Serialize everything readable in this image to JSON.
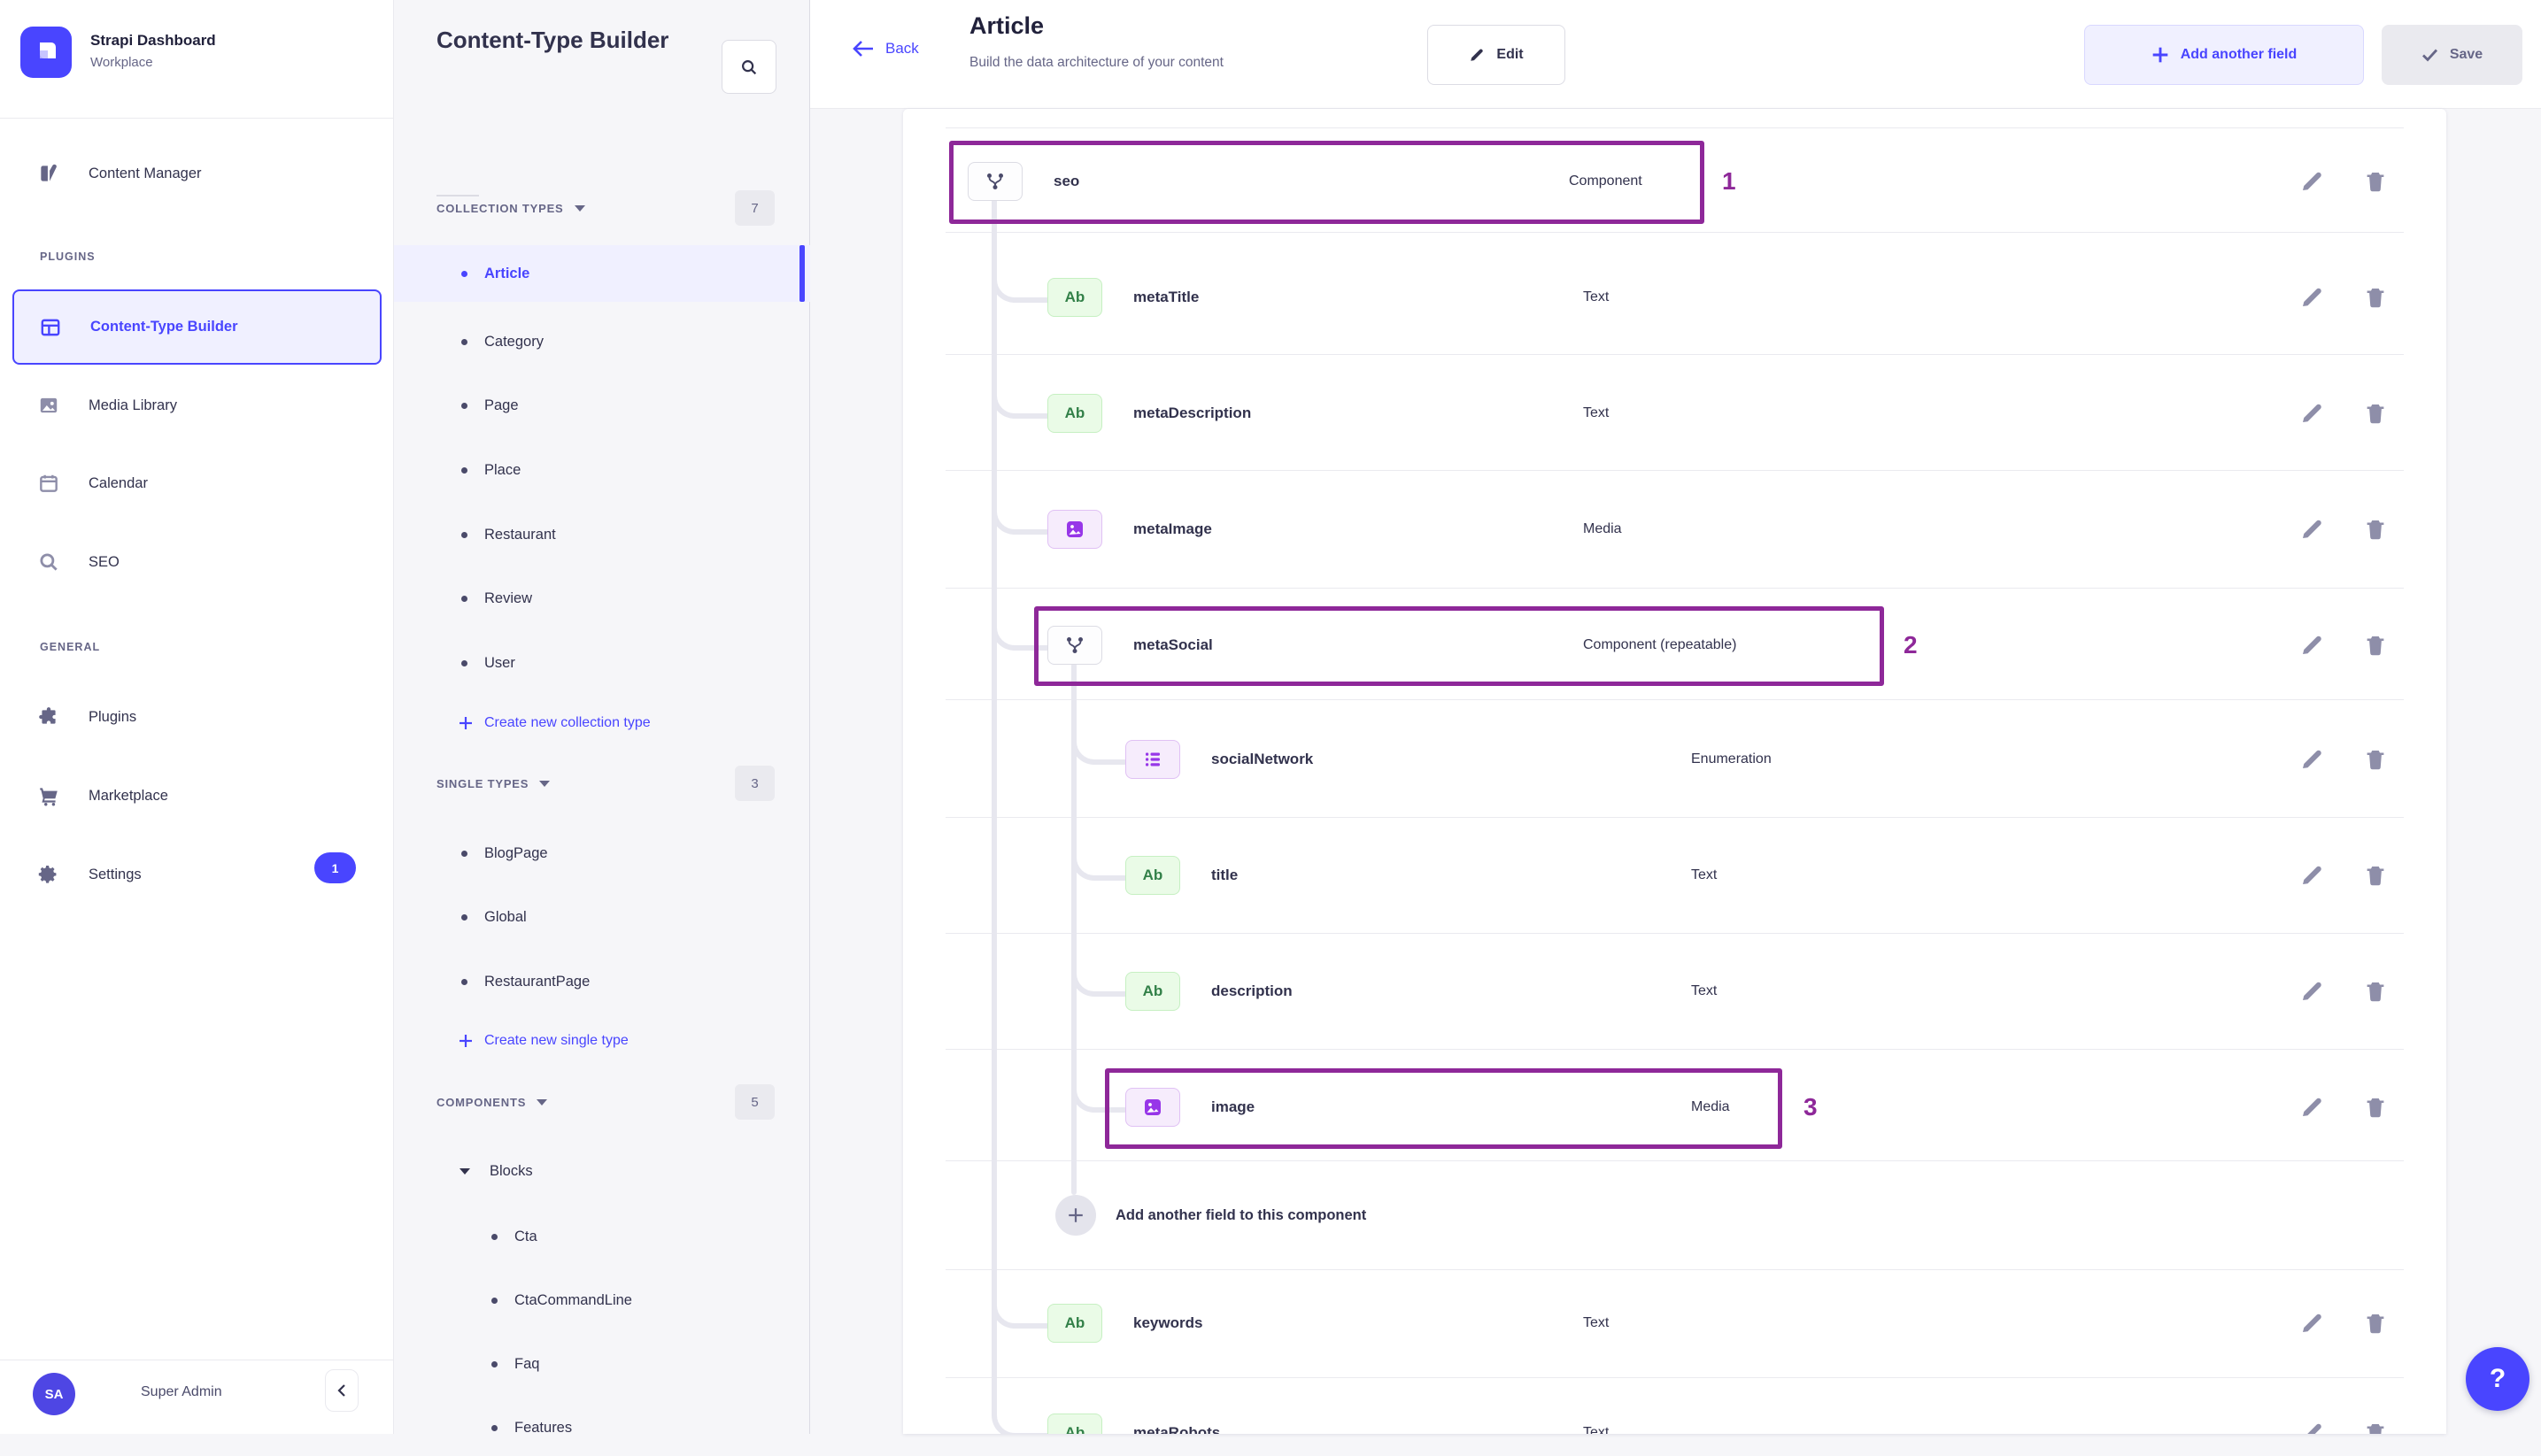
{
  "colors": {
    "accent": "#4945FF",
    "accent_bg": "#F0F0FF",
    "annotation": "#8E2899",
    "text_field_green": "#328048",
    "purple_field": "#9736E8"
  },
  "sidebar": {
    "app_title": "Strapi Dashboard",
    "app_subtitle": "Workplace",
    "content_manager": "Content Manager",
    "plugins_label": "PLUGINS",
    "general_label": "GENERAL",
    "plugins": {
      "ctb": "Content-Type Builder",
      "media_library": "Media Library",
      "calendar": "Calendar",
      "seo": "SEO"
    },
    "general": {
      "plugins": "Plugins",
      "marketplace": "Marketplace",
      "settings": "Settings",
      "settings_badge": "1"
    },
    "user": {
      "initials": "SA",
      "name": "Super Admin"
    }
  },
  "subnav": {
    "title": "Content-Type Builder",
    "collection_types": {
      "label": "COLLECTION TYPES",
      "count": "7",
      "items": [
        "Article",
        "Category",
        "Page",
        "Place",
        "Restaurant",
        "Review",
        "User"
      ],
      "create_label": "Create new collection type"
    },
    "single_types": {
      "label": "SINGLE TYPES",
      "count": "3",
      "items": [
        "BlogPage",
        "Global",
        "RestaurantPage"
      ],
      "create_label": "Create new single type"
    },
    "components": {
      "label": "COMPONENTS",
      "count": "5",
      "group": "Blocks",
      "items": [
        "Cta",
        "CtaCommandLine",
        "Faq",
        "Features"
      ]
    }
  },
  "header": {
    "back": "Back",
    "title": "Article",
    "subtitle": "Build the data architecture of your content",
    "edit": "Edit",
    "add_field": "Add another field",
    "save": "Save"
  },
  "table": {
    "text_icon_label": "Ab",
    "fields": [
      {
        "name": "seo",
        "type": "Component",
        "annotation": "1"
      },
      {
        "name": "metaTitle",
        "type": "Text"
      },
      {
        "name": "metaDescription",
        "type": "Text"
      },
      {
        "name": "metaImage",
        "type": "Media"
      },
      {
        "name": "metaSocial",
        "type": "Component (repeatable)",
        "annotation": "2"
      },
      {
        "name": "socialNetwork",
        "type": "Enumeration"
      },
      {
        "name": "title",
        "type": "Text"
      },
      {
        "name": "description",
        "type": "Text"
      },
      {
        "name": "image",
        "type": "Media",
        "annotation": "3"
      },
      {
        "name": "keywords",
        "type": "Text"
      },
      {
        "name": "metaRobots",
        "type": "Text"
      }
    ],
    "add_row_label": "Add another field to this component"
  },
  "help_label": "?"
}
